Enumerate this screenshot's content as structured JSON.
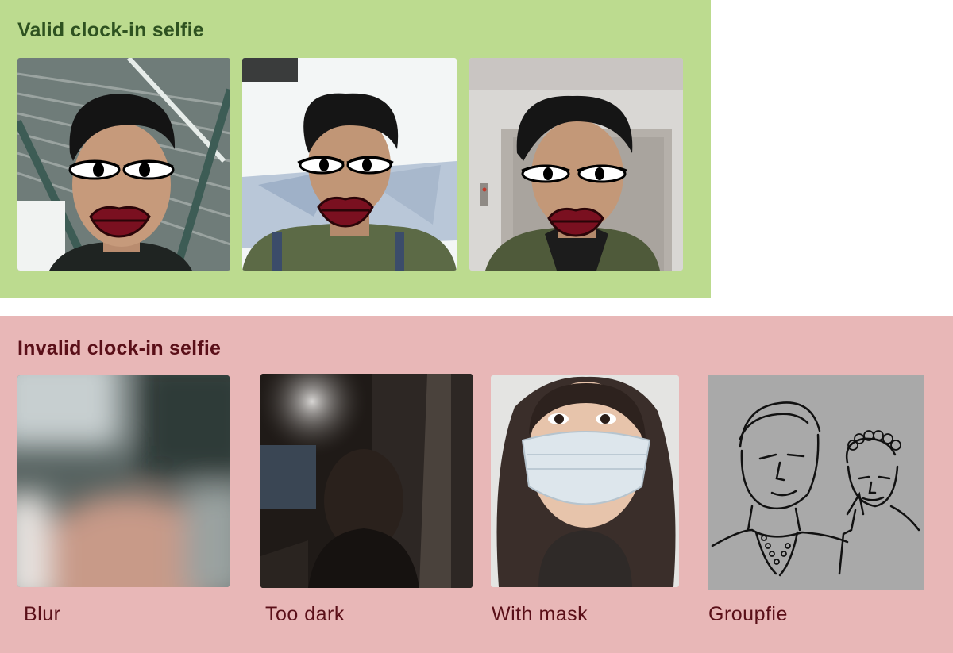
{
  "valid": {
    "title": "Valid clock-in selfie",
    "photos": [
      {
        "label": "",
        "icon": "selfie-photo-warehouse"
      },
      {
        "label": "",
        "icon": "selfie-photo-outdoor"
      },
      {
        "label": "",
        "icon": "selfie-photo-elevator"
      }
    ]
  },
  "invalid": {
    "title": "Invalid clock-in selfie",
    "photos": [
      {
        "caption": "Blur",
        "icon": "blurry-photo"
      },
      {
        "caption": "Too dark",
        "icon": "dark-photo"
      },
      {
        "caption": "With mask",
        "icon": "masked-face-photo"
      },
      {
        "caption": "Groupfie",
        "icon": "group-sketch-photo"
      }
    ]
  },
  "colors": {
    "valid_bg": "#bcdb8f",
    "invalid_bg": "#e8b7b7",
    "valid_title": "#2e5220",
    "invalid_text": "#5a0f18",
    "lips": "#7a1020"
  }
}
